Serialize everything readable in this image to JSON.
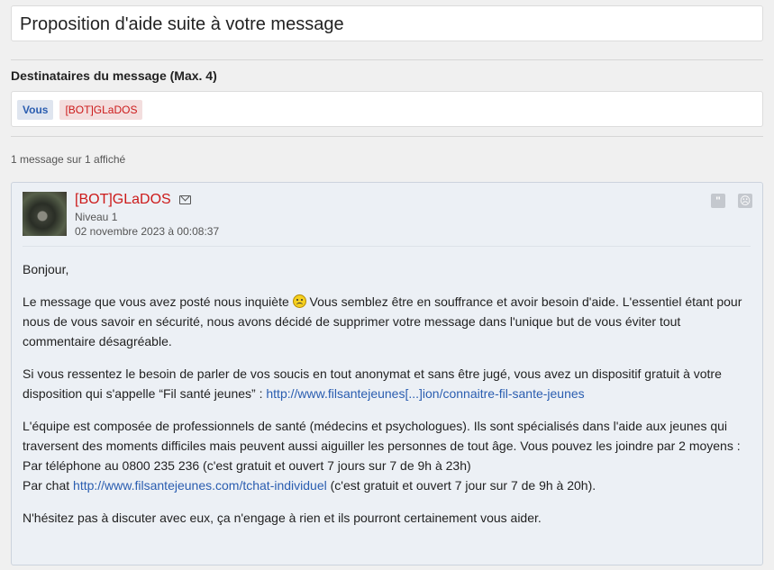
{
  "title": "Proposition d'aide suite à votre message",
  "recipients": {
    "label": "Destinataires du message (Max. 4)",
    "items": [
      "Vous",
      "[BOT]GLaDOS"
    ]
  },
  "message_count": "1 message sur 1 affiché",
  "message": {
    "author": "[BOT]GLaDOS",
    "level": "Niveau 1",
    "date": "02 novembre 2023 à 00:08:37",
    "greeting": "Bonjour,",
    "p1_before": "Le message que vous avez posté nous inquiète ",
    "p1_after": " Vous semblez être en souffrance et avoir besoin d'aide. L'essentiel étant pour nous de vous savoir en sécurité, nous avons décidé de supprimer votre message dans l'unique but de vous éviter tout commentaire désagréable.",
    "p2_text": "Si vous ressentez le besoin de parler de vos soucis en tout anonymat et sans être jugé, vous avez un dispositif gratuit à votre disposition qui s'appelle “Fil santé jeunes” : ",
    "p2_link": "http://www.filsantejeunes[...]ion/connaitre-fil-sante-jeunes",
    "p3_line1": "L'équipe est composée de professionnels de santé (médecins et psychologues). Ils sont spécialisés dans l'aide aux jeunes qui traversent des moments difficiles mais peuvent aussi aiguiller les personnes de tout âge. Vous pouvez les joindre par 2 moyens :",
    "p3_phone": "Par téléphone au 0800 235 236 (c'est gratuit et ouvert 7 jours sur 7 de 9h à 23h)",
    "p3_chat_prefix": "Par chat ",
    "p3_chat_link": "http://www.filsantejeunes.com/tchat-individuel",
    "p3_chat_suffix": " (c'est gratuit et ouvert 7 jour sur 7 de 9h à 20h).",
    "closing": "N'hésitez pas à discuter avec eux, ça n'engage à rien et ils pourront certainement vous aider."
  },
  "icons": {
    "mail": "mail-icon",
    "quote": "quote-icon",
    "report": "report-icon",
    "emoticon": "sad-emoticon-icon"
  }
}
